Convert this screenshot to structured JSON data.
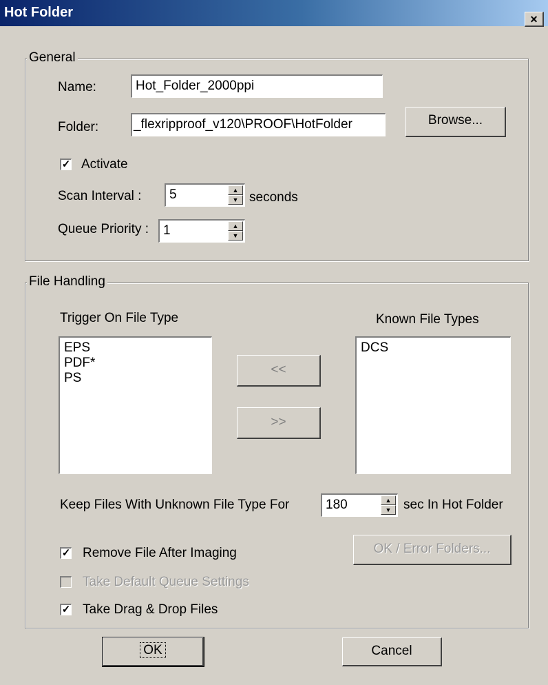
{
  "window": {
    "title": "Hot Folder",
    "close_glyph": "×"
  },
  "general": {
    "label": "General",
    "name_label": "Name:",
    "name_value": "Hot_Folder_2000ppi",
    "folder_label": "Folder:",
    "folder_value": "_flexripproof_v120\\PROOF\\HotFolder",
    "browse_label": "Browse...",
    "activate_label": "Activate",
    "activate_checked": true,
    "scan_interval_label": "Scan Interval  :",
    "scan_interval_value": "5",
    "scan_interval_unit": "seconds",
    "queue_priority_label": "Queue Priority :",
    "queue_priority_value": "1"
  },
  "file_handling": {
    "label": "File Handling",
    "trigger_header": "Trigger On File Type",
    "trigger_items": [
      "EPS",
      "PDF*",
      "PS"
    ],
    "known_header": "Known File Types",
    "known_items": [
      "DCS"
    ],
    "move_left_label": "<<",
    "move_right_label": ">>",
    "keep_files_label": "Keep Files With Unknown File Type For",
    "keep_files_value": "180",
    "keep_files_unit": "sec In Hot Folder",
    "remove_file_label": "Remove File After Imaging",
    "remove_file_checked": true,
    "take_default_label": "Take Default Queue Settings",
    "take_default_checked": false,
    "take_drag_label": "Take Drag & Drop Files",
    "take_drag_checked": true,
    "ok_error_label": "OK / Error Folders..."
  },
  "footer": {
    "ok_label": "OK",
    "cancel_label": "Cancel"
  },
  "glyphs": {
    "check": "✓",
    "spin_up": "▲",
    "spin_down": "▼"
  },
  "colors": {
    "face": "#d4d0c8",
    "title_start": "#0a246a",
    "title_end": "#a6caf0"
  }
}
